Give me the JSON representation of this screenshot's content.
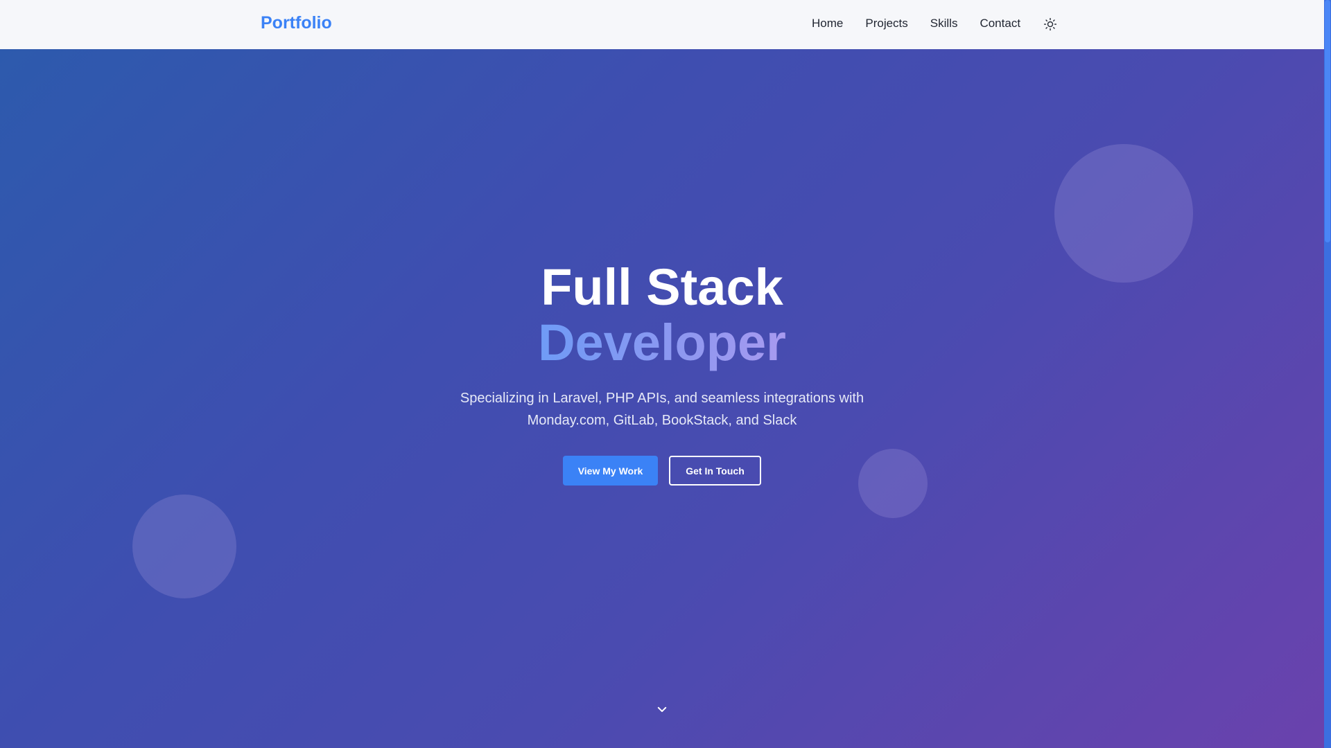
{
  "navbar": {
    "brand": "Portfolio",
    "links": [
      {
        "label": "Home"
      },
      {
        "label": "Projects"
      },
      {
        "label": "Skills"
      },
      {
        "label": "Contact"
      }
    ],
    "theme_toggle_icon": "sun-icon"
  },
  "hero": {
    "headline_line1": "Full Stack",
    "headline_line2": "Developer",
    "tagline": "Specializing in Laravel, PHP APIs, and seamless integrations with Monday.com, GitLab, BookStack, and Slack",
    "primary_cta": "View My Work",
    "secondary_cta": "Get In Touch",
    "scroll_icon": "chevron-down-icon"
  },
  "colors": {
    "accent": "#3b82f6",
    "nav_background": "#f6f7fa",
    "hero_gradient_start": "#2d5aad",
    "hero_gradient_end": "#6a42ad"
  }
}
